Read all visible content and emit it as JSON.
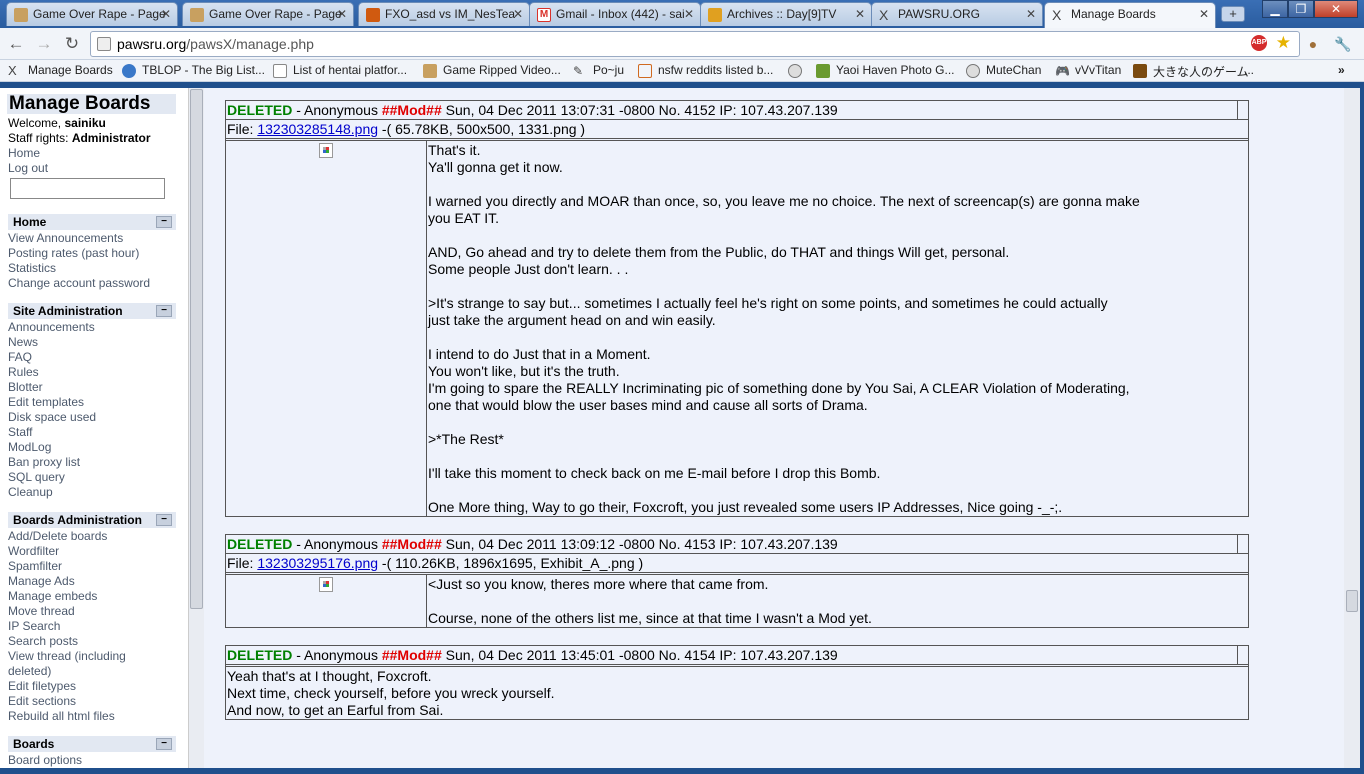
{
  "browser": {
    "tabs": [
      {
        "title": "Game Over Rape - Page",
        "color": "#c8a060"
      },
      {
        "title": "Game Over Rape - Page",
        "color": "#c8a060"
      },
      {
        "title": "FXO_asd vs IM_NesTea",
        "color": "#d05a10"
      },
      {
        "title": "Gmail - Inbox (442) - sai",
        "color": "#d9322b"
      },
      {
        "title": "Archives :: Day[9]TV",
        "color": "#e0a020"
      },
      {
        "title": "PAWSRU.ORG",
        "color": "#444444"
      },
      {
        "title": "Manage Boards",
        "color": "#444444"
      }
    ],
    "url_host": "pawsru.org",
    "url_path": "/pawsX/manage.php",
    "bookmarks": [
      {
        "label": "Manage Boards"
      },
      {
        "label": "TBLOP - The Big List..."
      },
      {
        "label": "List of hentai platfor..."
      },
      {
        "label": "Game Ripped Video..."
      },
      {
        "label": "Po~ju"
      },
      {
        "label": "nsfw reddits listed b..."
      },
      {
        "label": ""
      },
      {
        "label": "Yaoi Haven Photo G..."
      },
      {
        "label": "MuteChan"
      },
      {
        "label": "vVvTitan"
      },
      {
        "label": "大きな人のゲーム"
      }
    ],
    "bookmarks_more": "..."
  },
  "sidebar": {
    "title": "Manage Boards",
    "welcome_prefix": "Welcome, ",
    "username": "sainiku",
    "rights_prefix": "Staff rights: ",
    "rights": "Administrator",
    "links_top": [
      "Home",
      "Log out"
    ],
    "sections": [
      {
        "title": "Home",
        "items": [
          "View Announcements",
          "Posting rates (past hour)",
          "Statistics",
          "Change account password"
        ]
      },
      {
        "title": "Site Administration",
        "items": [
          "Announcements",
          "News",
          "FAQ",
          "Rules",
          "Blotter",
          "Edit templates",
          "Disk space used",
          "Staff",
          "ModLog",
          "Ban proxy list",
          "SQL query",
          "Cleanup"
        ]
      },
      {
        "title": "Boards Administration",
        "items": [
          "Add/Delete boards",
          "Wordfilter",
          "Spamfilter",
          "Manage Ads",
          "Manage embeds",
          "Move thread",
          "IP Search",
          "Search posts",
          "View thread (including",
          "deleted)",
          "Edit filetypes",
          "Edit sections",
          "Rebuild all html files"
        ]
      },
      {
        "title": "Boards",
        "items": [
          "Board options"
        ]
      }
    ],
    "collapse_symbol": "−"
  },
  "posts": [
    {
      "status": "DELETED",
      "author": "Anonymous",
      "tripcode": "##Mod##",
      "date": "Sun, 04 Dec 2011 13:07:31 -0800",
      "number": "No. 4152",
      "ip": "IP: 107.43.207.139",
      "file_prefix": "File: ",
      "file_name": "132303285148.png",
      "file_info": " -( 65.78KB, 500x500, 1331.png )",
      "lines": [
        "That's it.",
        "Ya'll gonna get it now.",
        "",
        "I warned you directly and MOAR than once, so, you leave me no choice. The next of screencap(s) are gonna make",
        "you EAT IT.",
        "",
        "AND, Go ahead and try to delete them from the Public, do THAT and things Will get, personal.",
        "Some people Just don't learn. . .",
        "",
        ">It's strange to say but... sometimes I actually feel he's right on some points, and sometimes he could actually",
        "just take the argument head on and win easily.",
        "",
        "I intend to do Just that in a Moment.",
        "You won't like, but it's the truth.",
        "I'm going to spare the REALLY Incriminating pic of something done by You Sai, A CLEAR Violation of Moderating,",
        "one that would blow the user bases mind and cause all sorts of Drama.",
        "",
        ">*The Rest*",
        "",
        "I'll take this moment to check back on me E-mail before I drop this Bomb.",
        "",
        "One More thing, Way to go their, Foxcroft, you just revealed some users IP Addresses, Nice going -_-;."
      ]
    },
    {
      "status": "DELETED",
      "author": "Anonymous",
      "tripcode": "##Mod##",
      "date": "Sun, 04 Dec 2011 13:09:12 -0800",
      "number": "No. 4153",
      "ip": "IP: 107.43.207.139",
      "file_prefix": "File: ",
      "file_name": "132303295176.png",
      "file_info": " -( 110.26KB, 1896x1695, Exhibit_A_.png )",
      "lines": [
        "<Just so you know, theres more where that came from.",
        "",
        "Course, none of the others list me, since at that time I wasn't a Mod yet."
      ]
    },
    {
      "status": "DELETED",
      "author": "Anonymous",
      "tripcode": "##Mod##",
      "date": "Sun, 04 Dec 2011 13:45:01 -0800",
      "number": "No. 4154",
      "ip": "IP: 107.43.207.139",
      "lines": [
        "Yeah that's at I thought, Foxcroft.",
        "",
        "Next time, check yourself, before you wreck yourself.",
        "",
        "And now, to get an Earful from Sai."
      ]
    }
  ],
  "colors": {
    "deleted": "#008000",
    "mod": "#e00000",
    "link": "#0000cc",
    "frame": "#1f4f8c"
  }
}
